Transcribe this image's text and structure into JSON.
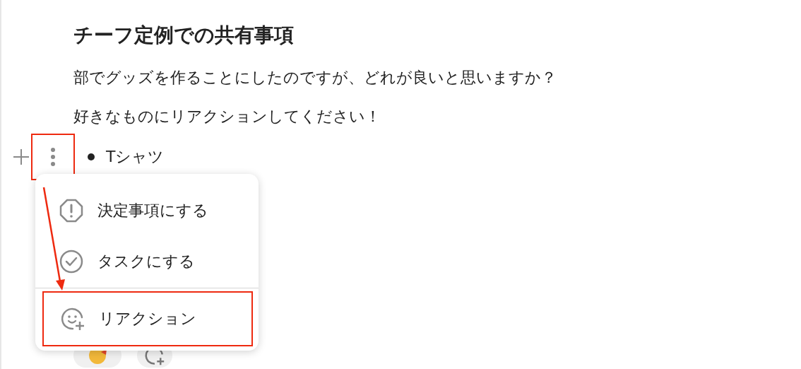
{
  "title": "チーフ定例での共有事項",
  "paragraphs": [
    "部でグッズを作ることにしたのですが、どれが良いと思いますか？",
    "好きなものにリアクションしてください！"
  ],
  "bullets": [
    {
      "text": "Tシャツ",
      "handle_annotated": true
    }
  ],
  "reactions": [
    {
      "kind": "emoji"
    },
    {
      "kind": "add"
    }
  ],
  "menu": {
    "items": [
      {
        "kind": "decision",
        "label": "決定事項にする",
        "annotated": false
      },
      {
        "kind": "task",
        "label": "タスクにする",
        "annotated": false
      },
      {
        "kind": "reaction",
        "label": "リアクション",
        "annotated": true
      }
    ]
  }
}
